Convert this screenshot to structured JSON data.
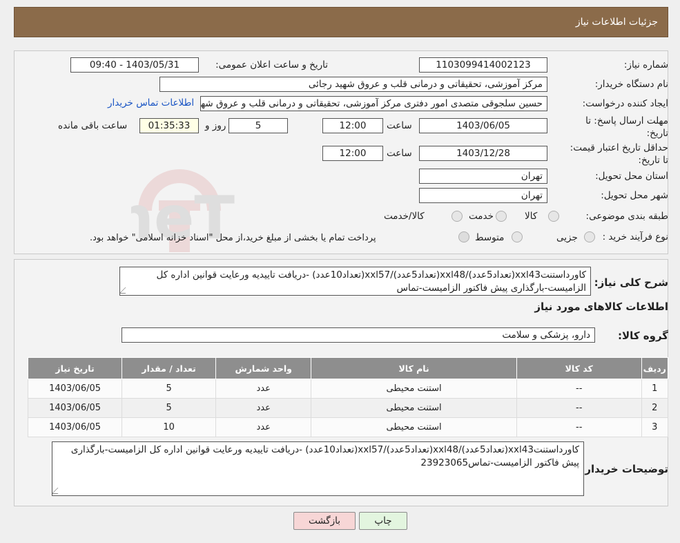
{
  "header": {
    "title": "جزئیات اطلاعات نیاز"
  },
  "form": {
    "need_number_label": "شماره نیاز:",
    "need_number": "1103099414002123",
    "announce_label": "تاریخ و ساعت اعلان عمومی:",
    "announce_value": "1403/05/31 - 09:40",
    "buyer_org_label": "نام دستگاه خریدار:",
    "buyer_org": "مرکز آموزشی، تحقیقاتی و درمانی قلب و عروق شهید رجائی",
    "requester_label": "ایجاد کننده درخواست:",
    "requester": "حسین سلجوقی متصدی امور دفتری مرکز آموزشی، تحقیقاتی و درمانی قلب و عروق شهید رجائی",
    "contact_link": "اطلاعات تماس خریدار",
    "deadline_label": "مهلت ارسال پاسخ: تا تاریخ:",
    "deadline_date": "1403/06/05",
    "time_label": "ساعت",
    "deadline_time": "12:00",
    "days_value": "5",
    "days_label": "روز و",
    "remaining_time": "01:35:33",
    "remaining_label": "ساعت باقی مانده",
    "validity_label": "حداقل تاریخ اعتبار قیمت: تا تاریخ:",
    "validity_date": "1403/12/28",
    "validity_time": "12:00",
    "province_label": "استان محل تحویل:",
    "province": "تهران",
    "city_label": "شهر محل تحویل:",
    "city": "تهران",
    "category_label": "طبقه بندی موضوعی:",
    "category_options": [
      "کالا",
      "خدمت",
      "کالا/خدمت"
    ],
    "purchase_type_label": "نوع فرآیند خرید :",
    "purchase_options": [
      "جزیی",
      "متوسط"
    ],
    "purchase_note": "پرداخت تمام یا بخشی از مبلغ خرید،از محل \"اسناد خزانه اسلامی\" خواهد بود."
  },
  "description": {
    "label": "شرح کلی نیاز:",
    "text": "کاورداستنتxxl43(تعداد5عدد)/xxl48(تعداد5عدد)/xxl57(تعداد10عدد) -دریافت تاییدیه ورعایت قوانین اداره کل الزامیست-بارگذاری پیش فاکتور الزامیست-تماس"
  },
  "goods": {
    "section_title": "اطلاعات کالاهای مورد نیاز",
    "group_label": "گروه کالا:",
    "group_value": "دارو، پزشکی و سلامت",
    "columns": [
      "ردیف",
      "کد کالا",
      "نام کالا",
      "واحد شمارش",
      "تعداد / مقدار",
      "تاریخ نیاز"
    ],
    "rows": [
      [
        "1",
        "--",
        "استنت محیطی",
        "عدد",
        "5",
        "1403/06/05"
      ],
      [
        "2",
        "--",
        "استنت محیطی",
        "عدد",
        "5",
        "1403/06/05"
      ],
      [
        "3",
        "--",
        "استنت محیطی",
        "عدد",
        "10",
        "1403/06/05"
      ]
    ]
  },
  "buyer_notes": {
    "label": "توضیحات خریدار:",
    "text": "کاورداستنتxxl43(تعداد5عدد)/xxl48(تعداد5عدد)/xxl57(تعداد10عدد) -دریافت تاییدیه ورعایت قوانین اداره کل الزامیست-بارگذاری پیش فاکتور الزامیست-تماس23923065"
  },
  "buttons": {
    "print": "چاپ",
    "back": "بازگشت"
  },
  "watermark": {
    "text": "AriaTender.neT"
  },
  "colors": {
    "header_bg": "#8b6b4a",
    "link": "#1a55c4",
    "back_button": "#f7d6d6",
    "print_button": "#e3f5df",
    "table_header": "#8e8e8e"
  }
}
